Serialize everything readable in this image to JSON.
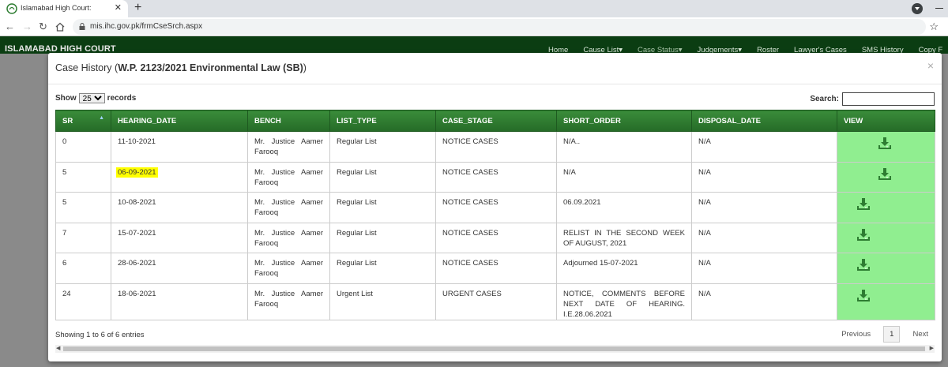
{
  "browser": {
    "tab_title": "Islamabad High Court:",
    "url": "mis.ihc.gov.pk/frmCseSrch.aspx"
  },
  "site": {
    "brand": "ISLAMABAD HIGH COURT",
    "menu": [
      "Home",
      "Cause List▾",
      "Case Status▾",
      "Judgements▾",
      "Roster",
      "Lawyer's Cases",
      "SMS History",
      "Copy F"
    ]
  },
  "modal": {
    "title_prefix": "Case History (",
    "title_bold": "W.P. 2123/2021 Environmental Law (SB)",
    "title_suffix": ")",
    "close": "×"
  },
  "controls": {
    "show_label": "Show",
    "page_length": "25",
    "records_label": "records",
    "search_label": "Search:",
    "search_value": ""
  },
  "table": {
    "columns": [
      "SR",
      "HEARING_DATE",
      "BENCH",
      "LIST_TYPE",
      "CASE_STAGE",
      "SHORT_ORDER",
      "DISPOSAL_DATE",
      "VIEW"
    ],
    "sort_indicator": "▲",
    "rows": [
      {
        "sr": "0",
        "hearing_date": "11-10-2021",
        "bench": "Mr. Justice Aamer Farooq",
        "list_type": "Regular List",
        "case_stage": "NOTICE CASES",
        "short_order": "N/A..",
        "disposal_date": "N/A"
      },
      {
        "sr": "5",
        "hearing_date": "06-09-2021",
        "bench": "Mr. Justice Aamer Farooq",
        "list_type": "Regular List",
        "case_stage": "NOTICE CASES",
        "short_order": "N/A",
        "disposal_date": "N/A"
      },
      {
        "sr": "5",
        "hearing_date": "10-08-2021",
        "bench": "Mr. Justice Aamer Farooq",
        "list_type": "Regular List",
        "case_stage": "NOTICE CASES",
        "short_order": "06.09.2021",
        "disposal_date": "N/A"
      },
      {
        "sr": "7",
        "hearing_date": "15-07-2021",
        "bench": "Mr. Justice Aamer Farooq",
        "list_type": "Regular List",
        "case_stage": "NOTICE CASES",
        "short_order": "RELIST IN THE SECOND WEEK OF AUGUST, 2021",
        "disposal_date": "N/A"
      },
      {
        "sr": "6",
        "hearing_date": "28-06-2021",
        "bench": "Mr. Justice Aamer Farooq",
        "list_type": "Regular List",
        "case_stage": "NOTICE CASES",
        "short_order": "Adjourned 15-07-2021",
        "disposal_date": "N/A"
      },
      {
        "sr": "24",
        "hearing_date": "18-06-2021",
        "bench": "Mr. Justice Aamer Farooq",
        "list_type": "Urgent List",
        "case_stage": "URGENT CASES",
        "short_order": "NOTICE, COMMENTS BEFORE NEXT DATE OF HEARING. I.E.28.06.2021",
        "disposal_date": "N/A"
      }
    ]
  },
  "footer": {
    "info": "Showing 1 to 6 of 6 entries",
    "previous": "Previous",
    "page": "1",
    "next": "Next"
  },
  "colors": {
    "header_green": "#2f7d32",
    "nav_green": "#0b3d12",
    "view_cell": "#90ee90",
    "download_icon": "#2e7d32",
    "highlight": "#ffff00"
  },
  "icons": [
    "download-icon",
    "lock-icon",
    "back-icon",
    "forward-icon",
    "reload-icon",
    "home-icon",
    "star-icon"
  ]
}
